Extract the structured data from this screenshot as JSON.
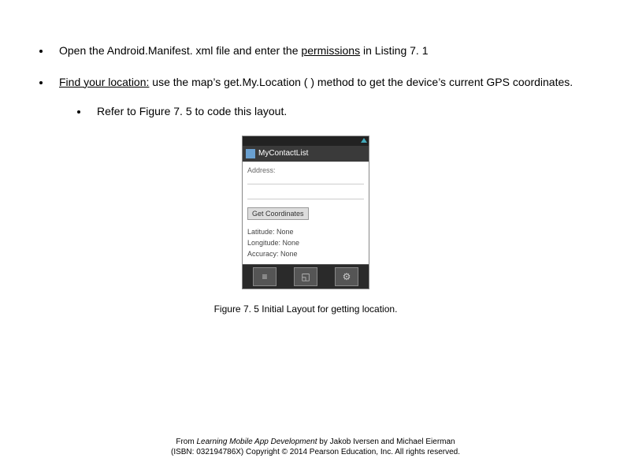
{
  "bullets": {
    "b1_pre": "Open the Android.Manifest. xml file and enter the ",
    "b1_u": "permissions",
    "b1_post": " in  Listing  7. 1",
    "b2_u": "Find your location:",
    "b2_post": "  use the map’s  get.My.Location ( ) method to get the device’s current GPS coordinates.",
    "b2_sub": "Refer to  Figure  7. 5 to code this layout."
  },
  "mock": {
    "app_title": "MyContactList",
    "address_label": "Address:",
    "button_label": "Get Coordinates",
    "lat": "Latitude: None",
    "lon": "Longitude: None",
    "acc": "Accuracy: None"
  },
  "caption": "Figure 7. 5   Initial Layout for getting location.",
  "footer": {
    "l1_pre": "From ",
    "l1_title": "Learning Mobile App Development",
    "l1_post": " by Jakob Iversen and Michael Eierman",
    "l2": "(ISBN: 032194786X) Copyright © 2014 Pearson Education, Inc. All rights reserved."
  }
}
